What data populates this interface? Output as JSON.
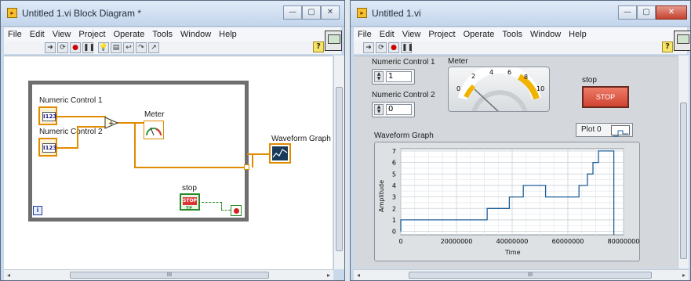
{
  "left_window": {
    "title": "Untitled 1.vi Block Diagram *",
    "menu": [
      "File",
      "Edit",
      "View",
      "Project",
      "Operate",
      "Tools",
      "Window",
      "Help"
    ],
    "loop_index": "i",
    "nodes": {
      "numeric1_label": "Numeric Control 1",
      "numeric1_icon": "I123",
      "numeric2_label": "Numeric Control 2",
      "numeric2_icon": "I123",
      "meter_label": "Meter",
      "graph_label": "Waveform Graph",
      "stop_label": "stop",
      "stop_text": "STOP",
      "stop_tf": "TF"
    },
    "scroll_mark": "III"
  },
  "right_window": {
    "title": "Untitled 1.vi",
    "menu": [
      "File",
      "Edit",
      "View",
      "Project",
      "Operate",
      "Tools",
      "Window",
      "Help"
    ],
    "numeric1": {
      "label": "Numeric Control 1",
      "value": "1"
    },
    "numeric2": {
      "label": "Numeric Control 2",
      "value": "0"
    },
    "meter": {
      "label": "Meter",
      "scale": [
        "0",
        "2",
        "4",
        "6",
        "8",
        "10"
      ],
      "value": 1,
      "min": 0,
      "max": 10
    },
    "stop": {
      "label": "stop",
      "button": "STOP"
    },
    "graph": {
      "label": "Waveform Graph",
      "legend": "Plot 0",
      "xlabel": "Time",
      "ylabel": "Amplitude",
      "xticks": [
        "0",
        "20000000",
        "40000000",
        "60000000",
        "80000000"
      ],
      "yticks": [
        "0",
        "1",
        "2",
        "3",
        "4",
        "5",
        "6",
        "7"
      ]
    },
    "scroll_mark": "III"
  },
  "chart_data": {
    "type": "line",
    "title": "Waveform Graph",
    "xlabel": "Time",
    "ylabel": "Amplitude",
    "xlim": [
      0,
      80000000
    ],
    "ylim": [
      -0.3,
      7.2
    ],
    "series": [
      {
        "name": "Plot 0",
        "x": [
          0,
          0,
          500000,
          500000,
          31000000,
          31000000,
          39000000,
          39000000,
          44000000,
          44000000,
          52000000,
          52000000,
          64000000,
          64000000,
          67000000,
          67000000,
          69000000,
          69000000,
          71000000,
          71000000,
          73000000,
          73000000,
          76500000,
          76500000
        ],
        "y": [
          0,
          1,
          1,
          1,
          1,
          2,
          2,
          3,
          3,
          4,
          4,
          3,
          3,
          4,
          4,
          5,
          5,
          6,
          6,
          7,
          7,
          7,
          7,
          -0.3
        ]
      }
    ],
    "colors": {
      "line": "#1f5f98",
      "grid": "#c9d0d6",
      "plot_bg": "#ffffff"
    }
  }
}
